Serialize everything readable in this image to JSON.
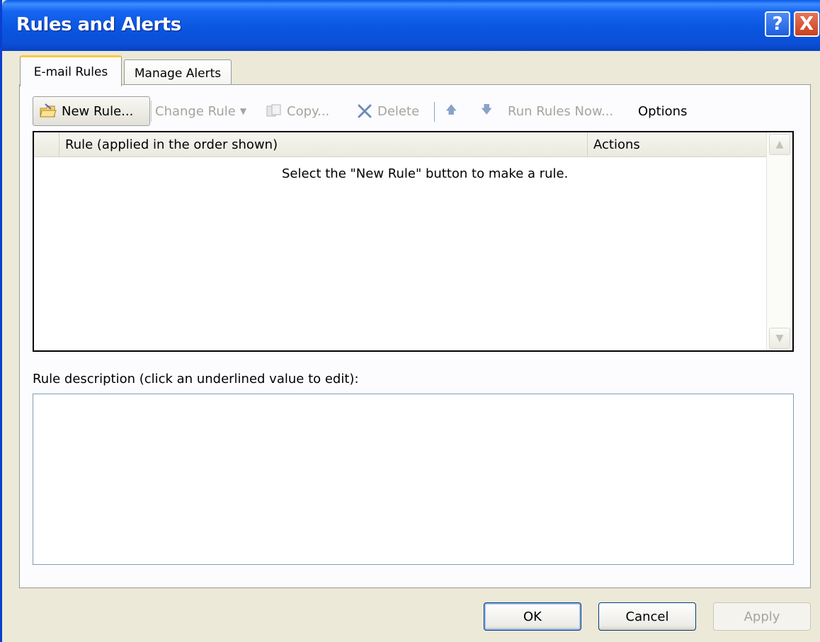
{
  "window": {
    "title": "Rules and Alerts",
    "help_glyph": "?",
    "close_glyph": "X"
  },
  "tabs": [
    {
      "label": "E-mail Rules",
      "active": true
    },
    {
      "label": "Manage Alerts",
      "active": false
    }
  ],
  "toolbar": {
    "new_rule": "New Rule...",
    "change_rule": "Change Rule",
    "copy": "Copy...",
    "delete": "Delete",
    "run_rules_now": "Run Rules Now...",
    "options": "Options"
  },
  "rules_list": {
    "columns": [
      "Rule (applied in the order shown)",
      "Actions"
    ],
    "empty_message": "Select the \"New Rule\" button to make a rule."
  },
  "description": {
    "label": "Rule description (click an underlined value to edit):"
  },
  "buttons": {
    "ok": "OK",
    "cancel": "Cancel",
    "apply": "Apply"
  },
  "colors": {
    "titlebar": "#0a56e0",
    "dialog_bg": "#ece9d8",
    "tab_highlight": "#ffc83c"
  }
}
